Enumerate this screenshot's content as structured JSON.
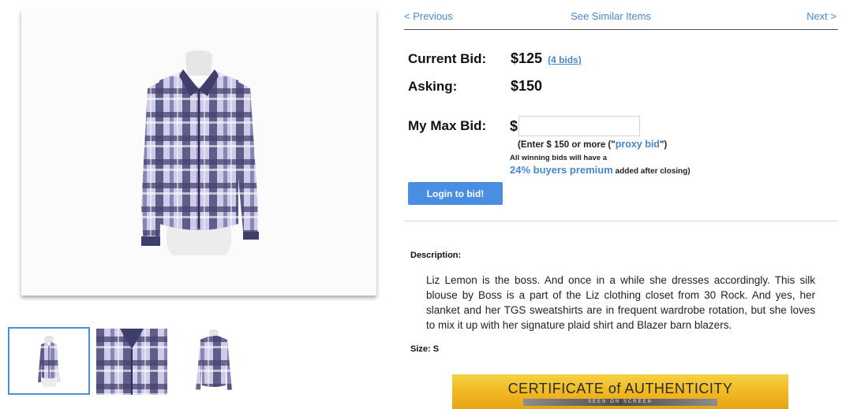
{
  "nav": {
    "previous": "< Previous",
    "similar": "See Similar Items",
    "next": "Next >"
  },
  "bid": {
    "current_label": "Current Bid:",
    "current_value": "$125",
    "bids_count": "(4 bids)",
    "asking_label": "Asking:",
    "asking_value": "$150",
    "max_label": "My Max Bid:",
    "currency": "$",
    "max_value": "",
    "enter_prefix": "(Enter $ 150 or more (\"",
    "proxy_link": "proxy bid",
    "enter_suffix": "\")",
    "winning_note": "All winning bids will have a",
    "premium_link": "24% buyers premium",
    "premium_suffix": " added after closing)"
  },
  "actions": {
    "login_label": "Login to bid!"
  },
  "description": {
    "heading": "Description:",
    "body": "Liz Lemon is the boss. And once in a while she dresses accordingly. This silk blouse by Boss is a part of the Liz clothing closet from 30 Rock. And yes, her slanket and her TGS sweatshirts are in frequent wardrobe rotation, but she loves to mix it up with her signature plaid shirt and Blazer barn blazers."
  },
  "size": {
    "line": "Size: S"
  },
  "certificate": {
    "title": "CERTIFICATE of AUTHENTICITY",
    "subtitle": "SEEN ON SCREEN"
  },
  "colors": {
    "accent": "#4a86c8",
    "button": "#4a8ee2",
    "plaid_dark": "#4b4a78",
    "plaid_light": "#c9c6e6",
    "gold": "#f0b620"
  },
  "images": {
    "main": "plaid-blouse-front-photo",
    "thumbs": [
      "plaid-blouse-front-thumb",
      "plaid-blouse-detail-thumb",
      "plaid-blouse-back-thumb"
    ]
  }
}
